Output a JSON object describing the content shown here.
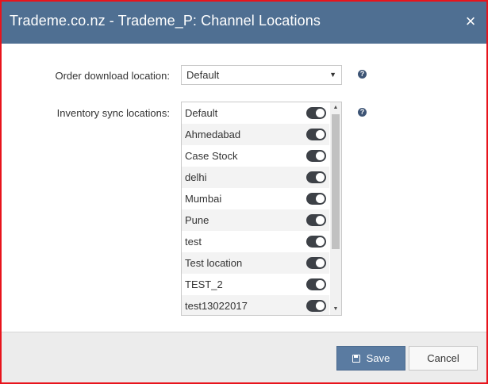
{
  "dialog": {
    "title": "Trademe.co.nz - Trademe_P: Channel Locations",
    "close_icon": "×"
  },
  "form": {
    "order_label": "Order download location:",
    "order_value": "Default",
    "inventory_label": "Inventory sync locations:",
    "help_icon": "?"
  },
  "locations": [
    {
      "name": "Default",
      "enabled": true
    },
    {
      "name": "Ahmedabad",
      "enabled": true
    },
    {
      "name": "Case Stock",
      "enabled": true
    },
    {
      "name": "delhi",
      "enabled": true
    },
    {
      "name": "Mumbai",
      "enabled": true
    },
    {
      "name": "Pune",
      "enabled": true
    },
    {
      "name": "test",
      "enabled": true
    },
    {
      "name": "Test location",
      "enabled": true
    },
    {
      "name": "TEST_2",
      "enabled": true
    },
    {
      "name": "test13022017",
      "enabled": true
    }
  ],
  "buttons": {
    "save": "Save",
    "cancel": "Cancel"
  },
  "colors": {
    "header": "#4f6f92",
    "border": "#e8141c",
    "save_button": "#5a7ba1",
    "toggle_on": "#3d4147"
  }
}
